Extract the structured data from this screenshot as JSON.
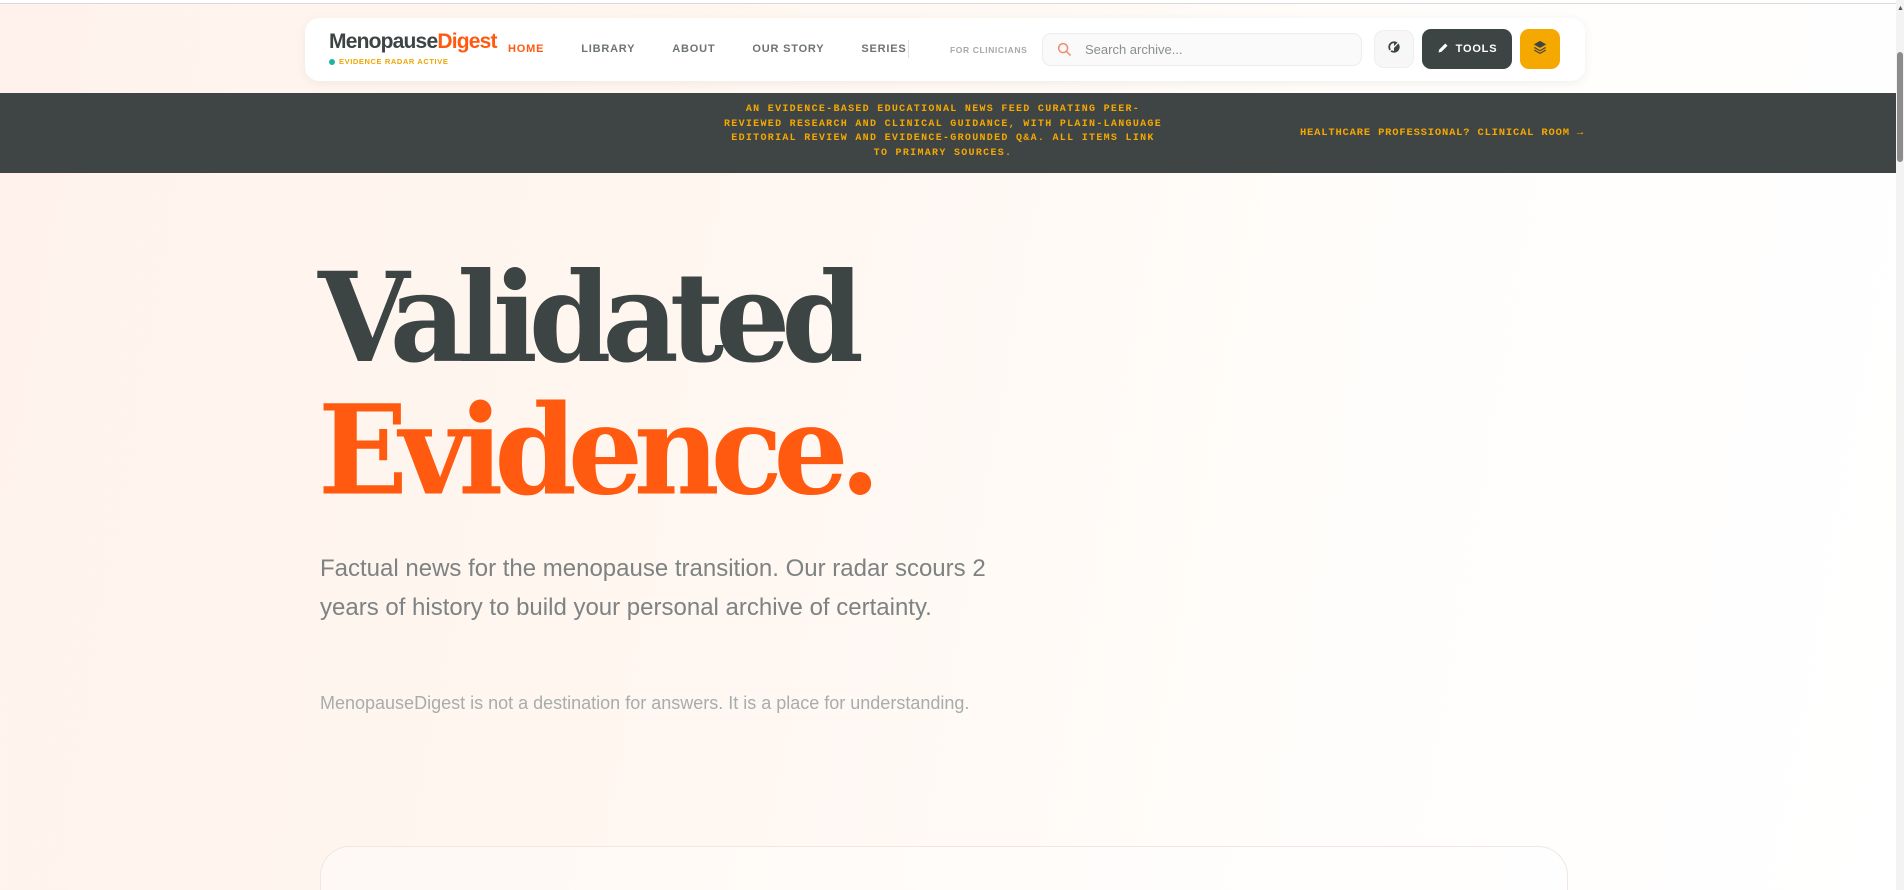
{
  "brand": {
    "name_part1": "Menopause",
    "name_part2": "Digest",
    "status": "EVIDENCE RADAR ACTIVE",
    "status_color": "#1bb5a7",
    "accent": "#ff5a10",
    "gold": "#f5a800",
    "dark": "#3d4444"
  },
  "nav": {
    "items": [
      {
        "label": "HOME",
        "active": true
      },
      {
        "label": "LIBRARY",
        "active": false
      },
      {
        "label": "ABOUT",
        "active": false
      },
      {
        "label": "OUR STORY",
        "active": false
      },
      {
        "label": "SERIES",
        "active": false
      }
    ],
    "clinicians": "FOR CLINICIANS"
  },
  "search": {
    "placeholder": "Search archive...",
    "value": "",
    "icon": "search-icon"
  },
  "toolbar": {
    "theme_icon": "contrast-icon",
    "tools_label": "TOOLS",
    "tools_icon": "pencil-icon",
    "layers_icon": "layers-icon"
  },
  "banner": {
    "text": "AN EVIDENCE-BASED EDUCATIONAL NEWS FEED CURATING PEER-REVIEWED RESEARCH AND CLINICAL GUIDANCE, WITH PLAIN-LANGUAGE EDITORIAL REVIEW AND EVIDENCE-GROUNDED Q&A. ALL ITEMS LINK TO PRIMARY SOURCES.",
    "link": "HEALTHCARE PROFESSIONAL? CLINICAL ROOM →"
  },
  "hero": {
    "title_line1": "Validated",
    "title_line2": "Evidence.",
    "subtitle": "Factual news for the menopause transition. Our radar scours 2 years of history to build your personal archive of certainty.",
    "note": "MenopauseDigest is not a destination for answers. It is a place for understanding."
  }
}
